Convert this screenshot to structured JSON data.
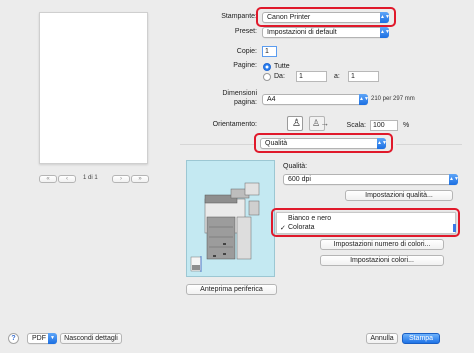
{
  "preview": {
    "page_indicator": "1 di 1",
    "nav_first": "«",
    "nav_prev": "‹",
    "nav_next": "›",
    "nav_last": "»"
  },
  "form": {
    "printer_label": "Stampante:",
    "printer_value": "Canon Printer",
    "preset_label": "Preset:",
    "preset_value": "Impostazioni di default",
    "copies_label": "Copie:",
    "copies_value": "1",
    "pages_label": "Pagine:",
    "pages_all": "Tutte",
    "pages_from_label": "Da:",
    "pages_from_value": "1",
    "pages_to_label": "a:",
    "pages_to_value": "1",
    "paper_label_line1": "Dimensioni",
    "paper_label_line2": "pagina:",
    "paper_value": "A4",
    "paper_dims": "210 per 297 mm",
    "orientation_label": "Orientamento:",
    "scale_label": "Scala:",
    "scale_value": "100",
    "scale_unit": "%",
    "section_value": "Qualità"
  },
  "quality": {
    "label": "Qualità:",
    "dpi_value": "600 dpi",
    "settings_button": "Impostazioni qualità...",
    "menu_items": [
      "Bianco e nero",
      "Colorata"
    ],
    "checkmark": "✓",
    "copies_settings_button": "Impostazioni numero di colori...",
    "color_settings_button": "Impostazioni colori...",
    "device_preview_button": "Anteprima periferica"
  },
  "bottom": {
    "help": "?",
    "pdf": "PDF",
    "hide_details": "Nascondi dettagli",
    "cancel": "Annulla",
    "print": "Stampa"
  },
  "colors": {
    "highlight": "#e0192b",
    "accent": "#1b6fe2",
    "device_bg": "#c4e9f2"
  }
}
